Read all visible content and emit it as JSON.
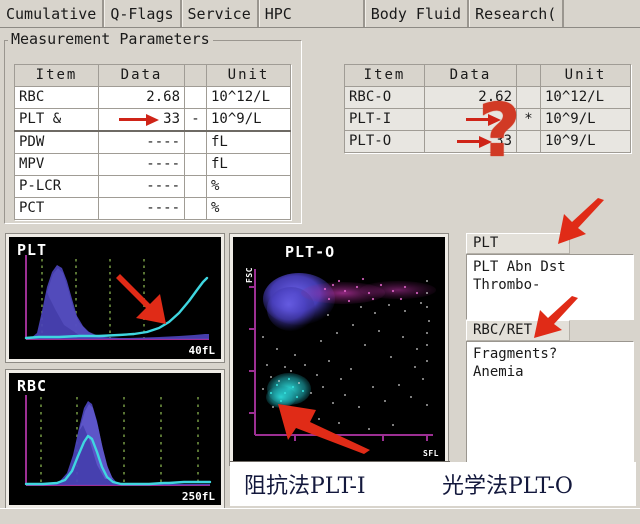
{
  "tabs": [
    {
      "label": "Cumulative"
    },
    {
      "label": "Q-Flags"
    },
    {
      "label": "Service"
    },
    {
      "label": "HPC"
    },
    {
      "label": "Body Fluid"
    },
    {
      "label": "Research("
    }
  ],
  "group": {
    "title": "Measurement Parameters"
  },
  "table_left": {
    "headers": [
      "Item",
      "Data",
      "",
      "Unit"
    ],
    "rows": [
      {
        "item": "RBC",
        "data": "2.68",
        "flag": "",
        "unit": "10^12/L",
        "arrow": false
      },
      {
        "item": "PLT  &",
        "data": "33",
        "flag": "-",
        "unit": "10^9/L",
        "arrow": true
      },
      {
        "item": "PDW",
        "data": "----",
        "flag": "",
        "unit": "fL",
        "arrow": false
      },
      {
        "item": "MPV",
        "data": "----",
        "flag": "",
        "unit": "fL",
        "arrow": false
      },
      {
        "item": "P-LCR",
        "data": "----",
        "flag": "",
        "unit": "%",
        "arrow": false
      },
      {
        "item": "PCT",
        "data": "----",
        "flag": "",
        "unit": "%",
        "arrow": false
      }
    ]
  },
  "table_right": {
    "headers": [
      "Item",
      "Data",
      "",
      "Unit"
    ],
    "rows": [
      {
        "item": "RBC-O",
        "data": "2.62",
        "flag": "",
        "unit": "10^12/L",
        "arrow": false
      },
      {
        "item": "PLT-I",
        "data": "3",
        "flag": "*",
        "unit": "10^9/L",
        "arrow": true
      },
      {
        "item": "PLT-O",
        "data": "33",
        "flag": "",
        "unit": "10^9/L",
        "arrow": true
      }
    ],
    "question_mark": "?"
  },
  "graphs": {
    "plt": {
      "title": "PLT",
      "scale": "40fL"
    },
    "rbc": {
      "title": "RBC",
      "scale": "250fL"
    },
    "scatter": {
      "title": "PLT-O",
      "y_axis": "FSC",
      "x_axis": "SFL"
    }
  },
  "flags": {
    "plt": {
      "header": "PLT",
      "lines": "PLT Abn Dst\nThrombo-"
    },
    "rbc_ret": {
      "header": "RBC/RET",
      "lines": "Fragments?\nAnemia"
    }
  },
  "captions": {
    "left": "阻抗法PLT-I",
    "right": "光学法PLT-O"
  },
  "colors": {
    "arrow_red": "#e02b17",
    "question_red": "#d13a25",
    "histogram_blue": "#4a43b8",
    "histogram_cyan": "#3fd6e0",
    "axis_magenta": "#a0339b",
    "grid_green": "#6a8a3a",
    "panel_bg": "#000000",
    "window_bg": "#d8d4cc",
    "caption_navy": "#13183c"
  }
}
